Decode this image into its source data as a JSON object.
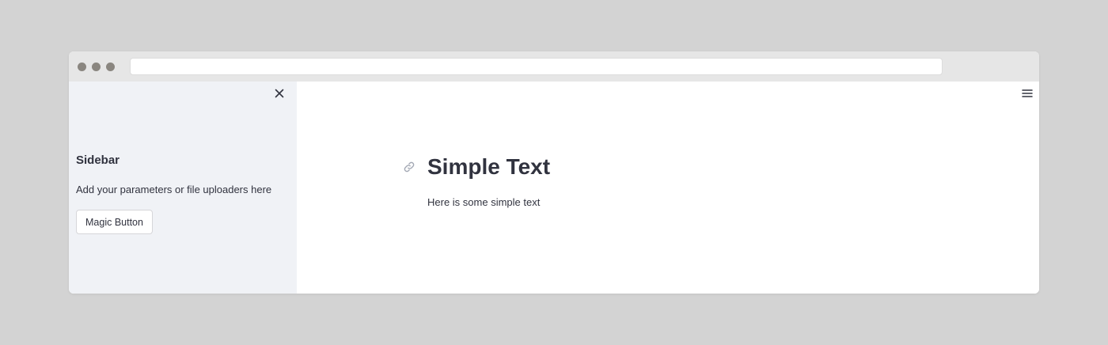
{
  "browser": {
    "url": ""
  },
  "sidebar": {
    "title": "Sidebar",
    "text": "Add your parameters or file uploaders here",
    "button_label": "Magic Button",
    "close_icon": "close-icon"
  },
  "main": {
    "title": "Simple Text",
    "text": "Here is some simple text",
    "menu_icon": "hamburger-menu-icon",
    "anchor_icon": "link-icon"
  },
  "colors": {
    "page_background": "#d3d3d3",
    "sidebar_background": "#f0f2f6",
    "titlebar_background": "#e6e6e6",
    "text": "#31333f"
  }
}
